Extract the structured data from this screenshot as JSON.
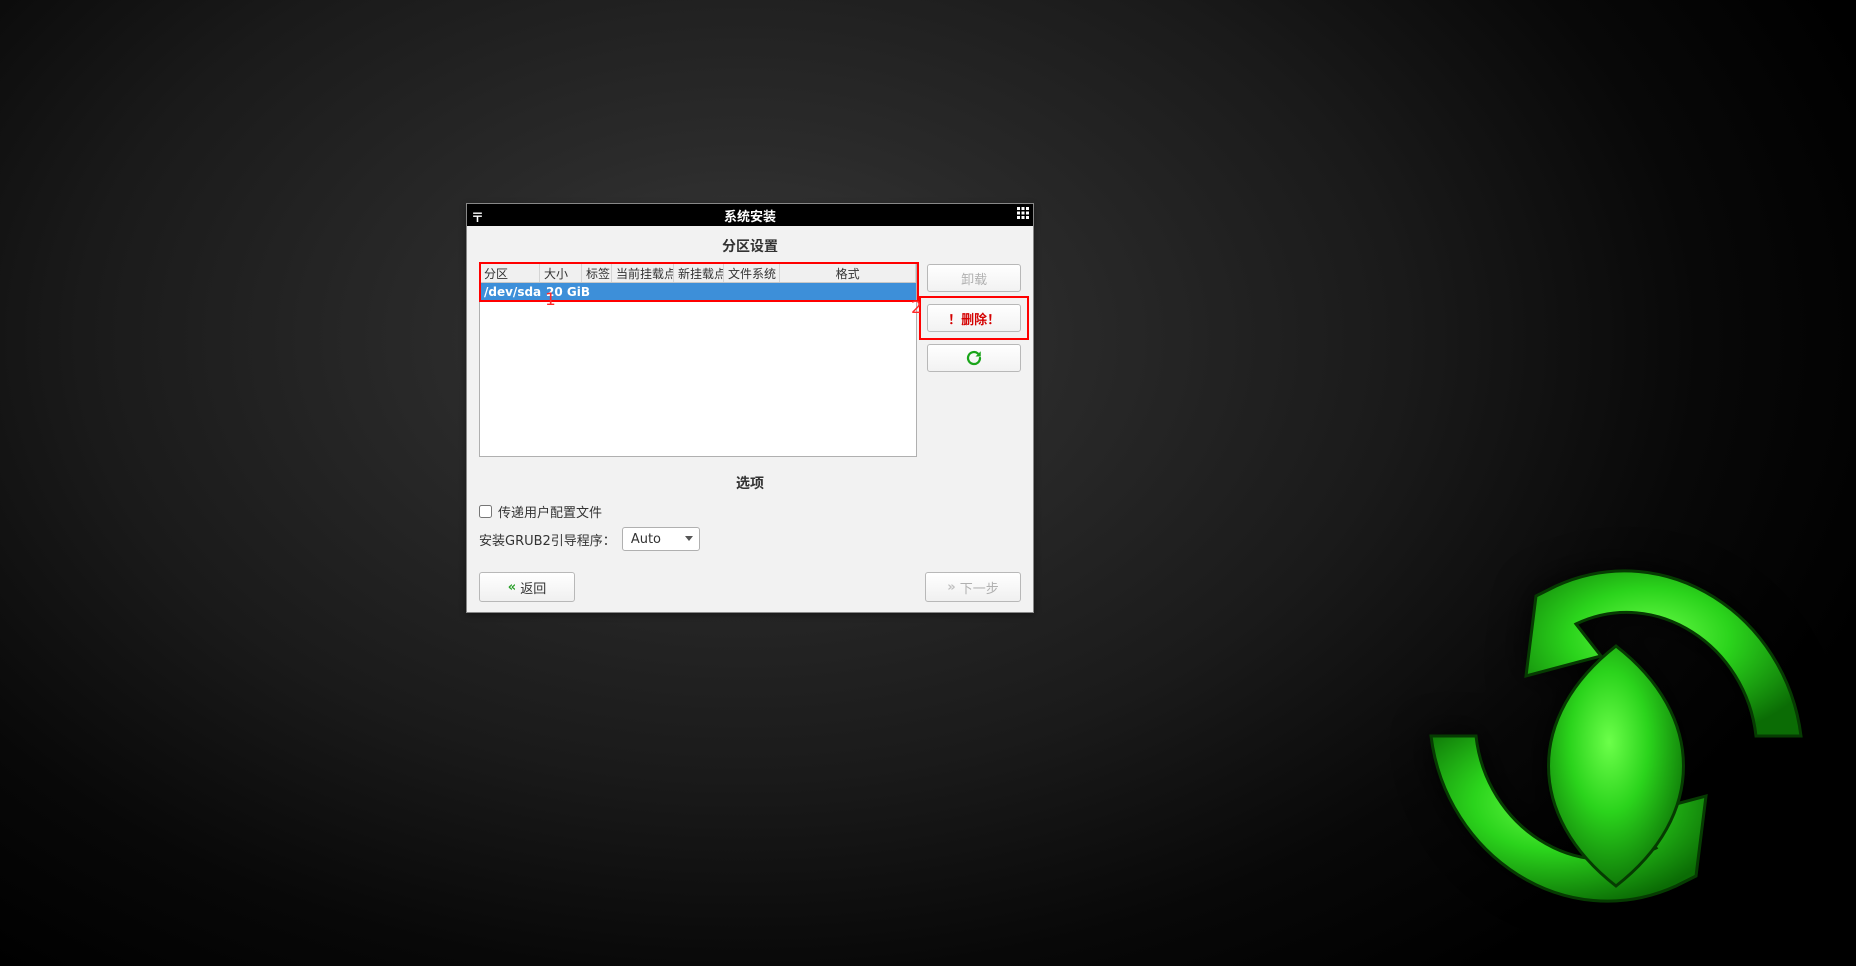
{
  "window": {
    "title": "系统安装"
  },
  "partition": {
    "section_title": "分区设置",
    "columns": {
      "partition": "分区",
      "size": "大小",
      "label": "标签",
      "current_mount": "当前挂载点",
      "new_mount": "新挂载点",
      "filesystem": "文件系统",
      "format": "格式"
    },
    "rows": [
      {
        "device": "/dev/sda",
        "size": "20 GiB"
      }
    ]
  },
  "side": {
    "unmount": "卸载",
    "delete": "！删除！"
  },
  "options": {
    "section_title": "选项",
    "transfer_user_config": "传递用户配置文件",
    "grub_label": "安装GRUB2引导程序：",
    "grub_value": "Auto"
  },
  "nav": {
    "back": "返回",
    "next": "下一步"
  },
  "annotations": {
    "one": "1",
    "two": "2"
  },
  "icons": {
    "refresh": "refresh-icon",
    "titlebar_left": "window-pin-icon",
    "titlebar_right": "window-menu-icon"
  }
}
